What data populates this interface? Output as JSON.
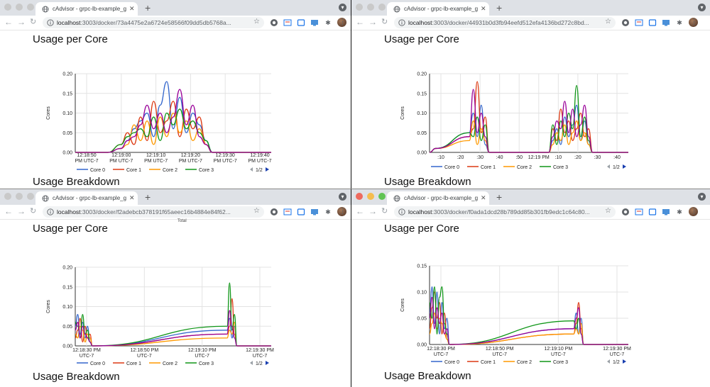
{
  "windows": [
    {
      "tab_title": "cAdvisor - grpc-lb-example_g",
      "url_host": "localhost",
      "url_path": ":3003/docker/73a4475e2a6724e58566f09dd5db5768a...",
      "active_lights": false,
      "heading_top": "Usage per Core",
      "heading_bottom": "Usage Breakdown",
      "cutoff_label": "",
      "legend_page": "1/2",
      "chart_data": {
        "type": "line",
        "ylabel": "Cores",
        "ylim": [
          0,
          0.2
        ],
        "yticks": [
          "0.00",
          "0.05",
          "0.10",
          "0.15",
          "0.20"
        ],
        "xticks": [
          "12:18:50\nPM UTC-7",
          "12:19:00\nPM UTC-7",
          "12:19:10\nPM UTC-7",
          "12:19:20\nPM UTC-7",
          "12:19:30\nPM UTC-7",
          "12:19:40\nPM UTC-7"
        ],
        "xlim": [
          0,
          60
        ],
        "series": [
          {
            "name": "Core 0",
            "color": "#3366cc",
            "x": [
              0,
              10,
              14,
              16,
              18,
              20,
              22,
              24,
              26,
              28,
              30,
              32,
              34,
              36,
              38,
              40,
              42,
              60
            ],
            "y": [
              0,
              0,
              0.01,
              0.03,
              0.06,
              0.08,
              0.1,
              0.04,
              0.12,
              0.18,
              0.06,
              0.14,
              0.05,
              0.1,
              0.07,
              0.03,
              0,
              0
            ]
          },
          {
            "name": "Core 1",
            "color": "#dc3912",
            "x": [
              0,
              10,
              14,
              16,
              18,
              20,
              22,
              24,
              26,
              28,
              30,
              32,
              34,
              36,
              38,
              40,
              42,
              60
            ],
            "y": [
              0,
              0,
              0.02,
              0.05,
              0.02,
              0.09,
              0.03,
              0.13,
              0.05,
              0.08,
              0.13,
              0.04,
              0.11,
              0.06,
              0.09,
              0.02,
              0,
              0
            ]
          },
          {
            "name": "Core 2",
            "color": "#ff9900",
            "x": [
              0,
              10,
              14,
              16,
              18,
              20,
              22,
              24,
              26,
              28,
              30,
              32,
              34,
              36,
              38,
              40,
              42,
              60
            ],
            "y": [
              0,
              0,
              0.01,
              0.02,
              0.07,
              0.03,
              0.08,
              0.02,
              0.09,
              0.04,
              0.1,
              0.05,
              0.08,
              0.03,
              0.06,
              0.02,
              0,
              0
            ]
          },
          {
            "name": "Core 3",
            "color": "#109618",
            "x": [
              0,
              10,
              14,
              16,
              18,
              20,
              22,
              24,
              26,
              28,
              30,
              32,
              34,
              36,
              38,
              40,
              42,
              60
            ],
            "y": [
              0,
              0,
              0.02,
              0.04,
              0.05,
              0.06,
              0.04,
              0.09,
              0.03,
              0.1,
              0.07,
              0.11,
              0.06,
              0.08,
              0.05,
              0.03,
              0,
              0
            ]
          },
          {
            "name": "",
            "color": "#990099",
            "x": [
              0,
              10,
              14,
              16,
              18,
              20,
              22,
              24,
              26,
              28,
              30,
              32,
              34,
              36,
              38,
              40,
              42,
              60
            ],
            "y": [
              0,
              0,
              0.01,
              0.03,
              0.04,
              0.07,
              0.12,
              0.06,
              0.1,
              0.05,
              0.09,
              0.16,
              0.07,
              0.12,
              0.04,
              0.02,
              0,
              0
            ]
          }
        ]
      }
    },
    {
      "tab_title": "cAdvisor - grpc-lb-example_g",
      "url_host": "localhost",
      "url_path": ":3003/docker/44931b0d3fb94eefd512efa4136bd272c8bd...",
      "active_lights": false,
      "heading_top": "Usage per Core",
      "heading_bottom": "Usage Breakdown",
      "cutoff_label": "",
      "legend_page": "1/2",
      "chart_data": {
        "type": "line",
        "ylabel": "Cores",
        "ylim": [
          0,
          0.2
        ],
        "yticks": [
          "0.00",
          "0.05",
          "0.10",
          "0.15",
          "0.20"
        ],
        "xticks": [
          ":10",
          ":20",
          ":30",
          ":40",
          ":50",
          "12:19 PM",
          ":10",
          ":20",
          ":30",
          ":40"
        ],
        "xlim": [
          0,
          100
        ],
        "series": [
          {
            "name": "Core 0",
            "color": "#3366cc",
            "x": [
              0,
              3,
              20,
              22,
              24,
              26,
              28,
              30,
              60,
              62,
              64,
              66,
              68,
              70,
              72,
              74,
              76,
              78,
              80,
              82,
              100
            ],
            "y": [
              0,
              0.01,
              0.05,
              0.1,
              0.04,
              0.12,
              0.02,
              0,
              0,
              0.03,
              0.06,
              0.02,
              0.09,
              0.04,
              0.07,
              0.12,
              0.03,
              0.08,
              0.02,
              0,
              0
            ]
          },
          {
            "name": "Core 1",
            "color": "#dc3912",
            "x": [
              0,
              3,
              20,
              22,
              24,
              26,
              28,
              30,
              60,
              62,
              64,
              66,
              68,
              70,
              72,
              74,
              76,
              78,
              80,
              82,
              100
            ],
            "y": [
              0,
              0.01,
              0.04,
              0.06,
              0.18,
              0.05,
              0.09,
              0,
              0,
              0.06,
              0.03,
              0.11,
              0.05,
              0.08,
              0.03,
              0.06,
              0.1,
              0.04,
              0.06,
              0,
              0
            ]
          },
          {
            "name": "Core 2",
            "color": "#ff9900",
            "x": [
              0,
              3,
              20,
              22,
              24,
              26,
              28,
              30,
              60,
              62,
              64,
              66,
              68,
              70,
              72,
              74,
              76,
              78,
              80,
              82,
              100
            ],
            "y": [
              0,
              0.01,
              0.03,
              0.08,
              0.02,
              0.06,
              0.03,
              0,
              0,
              0.02,
              0.05,
              0.03,
              0.07,
              0.02,
              0.05,
              0.08,
              0.03,
              0.05,
              0.02,
              0,
              0
            ]
          },
          {
            "name": "Core 3",
            "color": "#109618",
            "x": [
              0,
              3,
              20,
              22,
              24,
              26,
              28,
              30,
              60,
              62,
              64,
              66,
              68,
              70,
              72,
              74,
              76,
              78,
              80,
              82,
              100
            ],
            "y": [
              0,
              0.01,
              0.05,
              0.04,
              0.09,
              0.03,
              0.07,
              0,
              0,
              0.07,
              0.02,
              0.08,
              0.04,
              0.1,
              0.06,
              0.17,
              0.04,
              0.09,
              0.03,
              0,
              0
            ]
          },
          {
            "name": "",
            "color": "#990099",
            "x": [
              0,
              3,
              20,
              22,
              24,
              26,
              28,
              30,
              60,
              62,
              64,
              66,
              68,
              70,
              72,
              74,
              76,
              78,
              80,
              82,
              100
            ],
            "y": [
              0,
              0.01,
              0.04,
              0.16,
              0.05,
              0.1,
              0.04,
              0,
              0,
              0.04,
              0.08,
              0.06,
              0.13,
              0.05,
              0.11,
              0.04,
              0.07,
              0.12,
              0.04,
              0,
              0
            ]
          }
        ]
      }
    },
    {
      "tab_title": "cAdvisor - grpc-lb-example_g",
      "url_host": "localhost",
      "url_path": ":3003/docker/f2adebcb378191f65aeec16b4884e84f62...",
      "active_lights": false,
      "heading_top": "Usage per Core",
      "heading_bottom": "Usage Breakdown",
      "cutoff_label": "Total",
      "legend_page": "1/2",
      "chart_data": {
        "type": "line",
        "ylabel": "Cores",
        "ylim": [
          0,
          0.2
        ],
        "yticks": [
          "0.00",
          "0.05",
          "0.10",
          "0.15",
          "0.20"
        ],
        "xticks": [
          "12:18:30 PM\nUTC-7",
          "12:18:50 PM\nUTC-7",
          "12:19:10 PM\nUTC-7",
          "12:19:30 PM\nUTC-7"
        ],
        "xlim": [
          0,
          80
        ],
        "series": [
          {
            "name": "Core 0",
            "color": "#3366cc",
            "x": [
              0,
              1,
              2,
              3,
              4,
              5,
              6,
              7,
              62,
              63,
              64,
              65,
              66,
              80
            ],
            "y": [
              0.05,
              0.08,
              0.03,
              0.06,
              0.02,
              0.05,
              0.01,
              0,
              0.04,
              0.07,
              0.02,
              0.05,
              0,
              0
            ]
          },
          {
            "name": "Core 1",
            "color": "#dc3912",
            "x": [
              0,
              1,
              2,
              3,
              4,
              5,
              6,
              7,
              62,
              63,
              64,
              65,
              66,
              80
            ],
            "y": [
              0.02,
              0.04,
              0.07,
              0.01,
              0.05,
              0.02,
              0.03,
              0,
              0.03,
              0.05,
              0.12,
              0.03,
              0,
              0
            ]
          },
          {
            "name": "Core 2",
            "color": "#ff9900",
            "x": [
              0,
              1,
              2,
              3,
              4,
              5,
              6,
              7,
              62,
              63,
              64,
              65,
              66,
              80
            ],
            "y": [
              0.03,
              0.02,
              0.05,
              0.04,
              0.01,
              0.03,
              0.02,
              0,
              0.02,
              0.04,
              0.03,
              0.06,
              0,
              0
            ]
          },
          {
            "name": "Core 3",
            "color": "#109618",
            "x": [
              0,
              1,
              2,
              3,
              4,
              5,
              6,
              7,
              62,
              63,
              64,
              65,
              66,
              80
            ],
            "y": [
              0.06,
              0.05,
              0.02,
              0.08,
              0.03,
              0.04,
              0.01,
              0,
              0.05,
              0.16,
              0.04,
              0.08,
              0,
              0
            ]
          },
          {
            "name": "",
            "color": "#990099",
            "x": [
              0,
              1,
              2,
              3,
              4,
              5,
              6,
              7,
              62,
              63,
              64,
              65,
              66,
              80
            ],
            "y": [
              0.04,
              0.06,
              0.02,
              0.05,
              0.03,
              0.02,
              0.01,
              0,
              0.03,
              0.09,
              0.05,
              0.02,
              0,
              0
            ]
          }
        ]
      }
    },
    {
      "tab_title": "cAdvisor - grpc-lb-example_g",
      "url_host": "localhost",
      "url_path": ":3003/docker/f0ada1dcd28b789dd85b301fb9edc1c64c80...",
      "active_lights": true,
      "heading_top": "Usage per Core",
      "heading_bottom": "Usage Breakdown",
      "cutoff_label": "",
      "legend_page": "1/2",
      "chart_data": {
        "type": "line",
        "ylabel": "Cores",
        "ylim": [
          0,
          0.15
        ],
        "yticks": [
          "0.00",
          "0.05",
          "0.10",
          "0.15"
        ],
        "xticks": [
          "12:18:30 PM\nUTC-7",
          "12:18:50 PM\nUTC-7",
          "12:19:10 PM\nUTC-7",
          "12:19:30 PM\nUTC-7"
        ],
        "xlim": [
          0,
          80
        ],
        "series": [
          {
            "name": "Core 0",
            "color": "#3366cc",
            "x": [
              0,
              1,
              2,
              3,
              4,
              5,
              6,
              7,
              8,
              58,
              59,
              60,
              61,
              62,
              80
            ],
            "y": [
              0.06,
              0.11,
              0.04,
              0.1,
              0.02,
              0.08,
              0.03,
              0.05,
              0,
              0.03,
              0.06,
              0.02,
              0.05,
              0,
              0
            ]
          },
          {
            "name": "Core 1",
            "color": "#dc3912",
            "x": [
              0,
              1,
              2,
              3,
              4,
              5,
              6,
              7,
              8,
              58,
              59,
              60,
              61,
              62,
              80
            ],
            "y": [
              0.03,
              0.07,
              0.1,
              0.05,
              0.08,
              0.02,
              0.06,
              0.01,
              0,
              0.02,
              0.04,
              0.08,
              0.03,
              0,
              0
            ]
          },
          {
            "name": "Core 2",
            "color": "#ff9900",
            "x": [
              0,
              1,
              2,
              3,
              4,
              5,
              6,
              7,
              8,
              58,
              59,
              60,
              61,
              62,
              80
            ],
            "y": [
              0.02,
              0.04,
              0.06,
              0.03,
              0.05,
              0.04,
              0.02,
              0.01,
              0,
              0.02,
              0.03,
              0.02,
              0.04,
              0,
              0
            ]
          },
          {
            "name": "Core 3",
            "color": "#109618",
            "x": [
              0,
              1,
              2,
              3,
              4,
              5,
              6,
              7,
              8,
              58,
              59,
              60,
              61,
              62,
              80
            ],
            "y": [
              0.08,
              0.05,
              0.11,
              0.02,
              0.09,
              0.11,
              0.04,
              0.02,
              0,
              0.045,
              0.03,
              0.05,
              0.02,
              0,
              0
            ]
          },
          {
            "name": "",
            "color": "#990099",
            "x": [
              0,
              1,
              2,
              3,
              4,
              5,
              6,
              7,
              8,
              58,
              59,
              60,
              61,
              62,
              80
            ],
            "y": [
              0.05,
              0.09,
              0.03,
              0.07,
              0.04,
              0.06,
              0.02,
              0.03,
              0,
              0.03,
              0.05,
              0.07,
              0.02,
              0,
              0
            ]
          }
        ]
      }
    }
  ]
}
